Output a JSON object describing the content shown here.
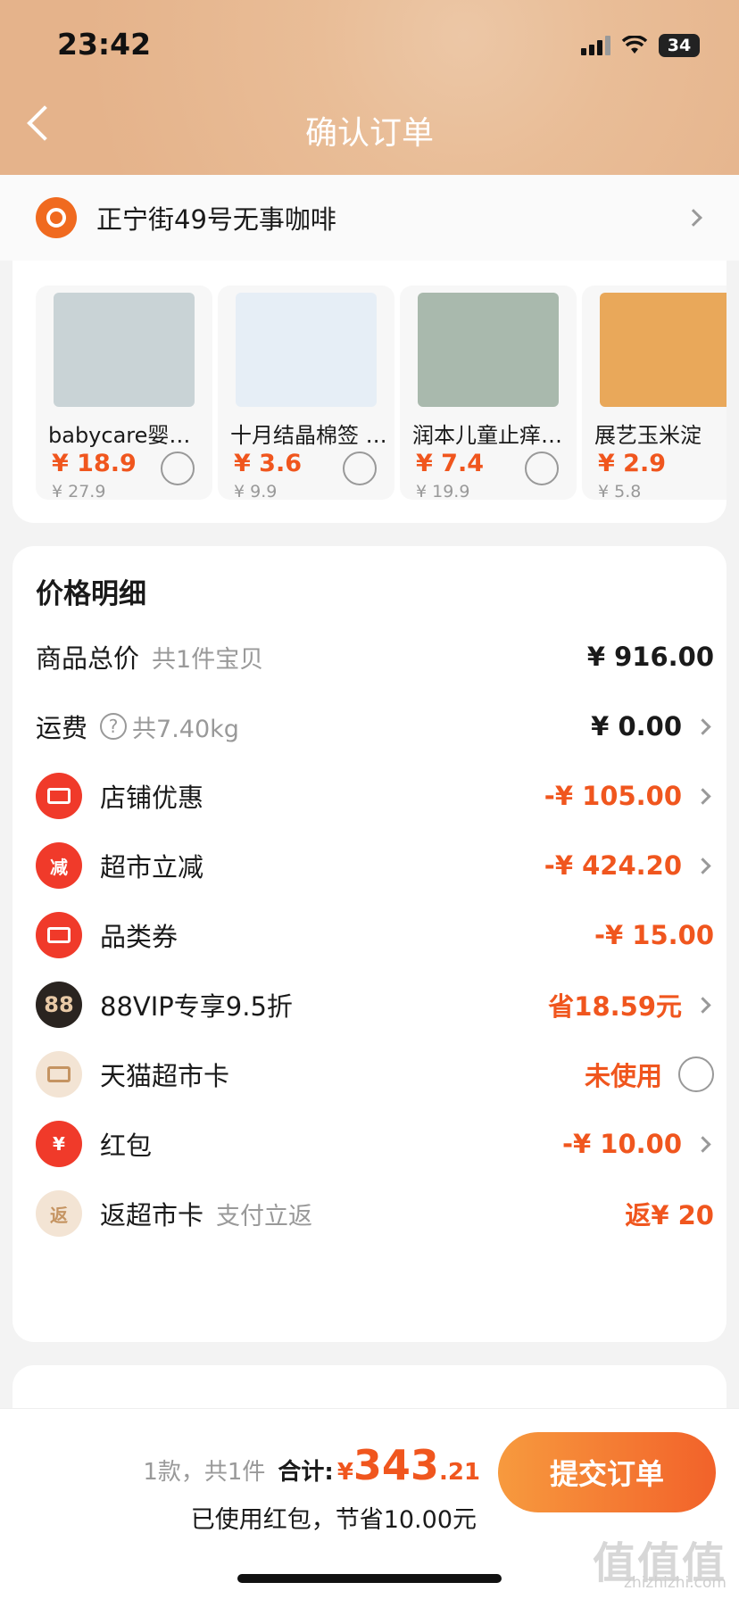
{
  "status": {
    "time": "23:42",
    "battery": "34"
  },
  "header": {
    "title": "确认订单"
  },
  "address": {
    "text": "正宁街49号无事咖啡"
  },
  "recommendations": [
    {
      "name": "babycare婴…",
      "price": "¥ 18.9",
      "original": "¥ 27.9",
      "color": "#c9d3d6"
    },
    {
      "name": "十月结晶棉签 …",
      "price": "¥ 3.6",
      "original": "¥ 9.9",
      "color": "#e6eef6"
    },
    {
      "name": "润本儿童止痒…",
      "price": "¥ 7.4",
      "original": "¥ 19.9",
      "color": "#a9b9ad"
    },
    {
      "name": "展艺玉米淀",
      "price": "¥ 2.9",
      "original": "¥ 5.8",
      "color": "#e9a85a"
    }
  ],
  "price_detail": {
    "title": "价格明细",
    "goods_total": {
      "label": "商品总价",
      "sub": "共1件宝贝",
      "value": "¥ 916.00"
    },
    "shipping": {
      "label": "运费",
      "sub": "共7.40kg",
      "value": "¥ 0.00"
    },
    "shop_discount": {
      "label": "店铺优惠",
      "value": "-¥ 105.00"
    },
    "market_reduce": {
      "label": "超市立减",
      "icon_text": "减",
      "value": "-¥ 424.20"
    },
    "category_coupon": {
      "label": "品类券",
      "value": "-¥ 15.00"
    },
    "vip": {
      "label": "88VIP专享9.5折",
      "icon_text": "88",
      "value": "省18.59元"
    },
    "market_card": {
      "label": "天猫超市卡",
      "value": "未使用"
    },
    "red_packet": {
      "label": "红包",
      "icon_text": "¥",
      "value": "-¥ 10.00"
    },
    "cashback": {
      "label": "返超市卡",
      "sub": "支付立返",
      "icon_text": "返",
      "value": "返¥ 20"
    }
  },
  "footer": {
    "count": "1款，共1件",
    "total_label": "合计:",
    "yen": "¥",
    "total_int": "343",
    "total_dec": ".21",
    "saved": "已使用红包，节省10.00元",
    "submit": "提交订单"
  },
  "watermark": {
    "main": "值值值",
    "url": "zhizhizhi.com"
  }
}
